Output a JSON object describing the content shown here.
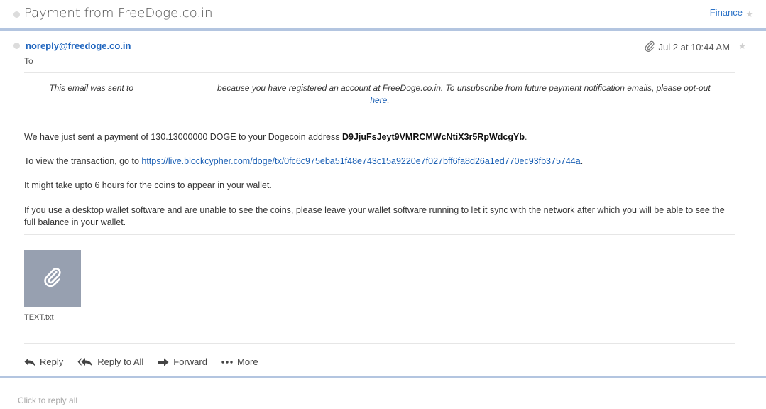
{
  "subject": {
    "title": "Payment from FreeDoge.co.in",
    "folder": "Finance"
  },
  "message": {
    "sender": "noreply@freedoge.co.in",
    "to_label": "To",
    "date": "Jul 2 at 10:44 AM",
    "notice": {
      "before": "This email was sent to",
      "after": "because you have registered an account at FreeDoge.co.in. To unsubscribe from future payment notification emails, please opt-out",
      "link": "here",
      "end": "."
    },
    "body": {
      "p1_text": "We have just sent a payment of 130.13000000 DOGE to your Dogecoin address ",
      "p1_address": "D9JjuFsJeyt9VMRCMWcNtiX3r5RpWdcgYb",
      "p1_end": ".",
      "p2_text": "To view the transaction, go to ",
      "p2_link": "https://live.blockcypher.com/doge/tx/0fc6c975eba51f48e743c15a9220e7f027bff6fa8d26a1ed770ec93fb375744a",
      "p2_end": ".",
      "p3": "It might take upto 6 hours for the coins to appear in your wallet.",
      "p4": "If you use a desktop wallet software and are unable to see the coins, please leave your wallet software running to let it sync with the network after which you will be able to see the full balance in your wallet."
    },
    "attachment": {
      "name": "TEXT.txt",
      "icon": "paperclip-icon"
    },
    "actions": {
      "reply": "Reply",
      "reply_all": "Reply to All",
      "forward": "Forward",
      "more": "More"
    }
  },
  "reply_box": {
    "placeholder": "Click to reply all"
  },
  "colors": {
    "link": "#1a5fb4",
    "sender": "#2166bf",
    "card_border": "#b3c5e0",
    "attachment_bg": "#97a0b0"
  }
}
